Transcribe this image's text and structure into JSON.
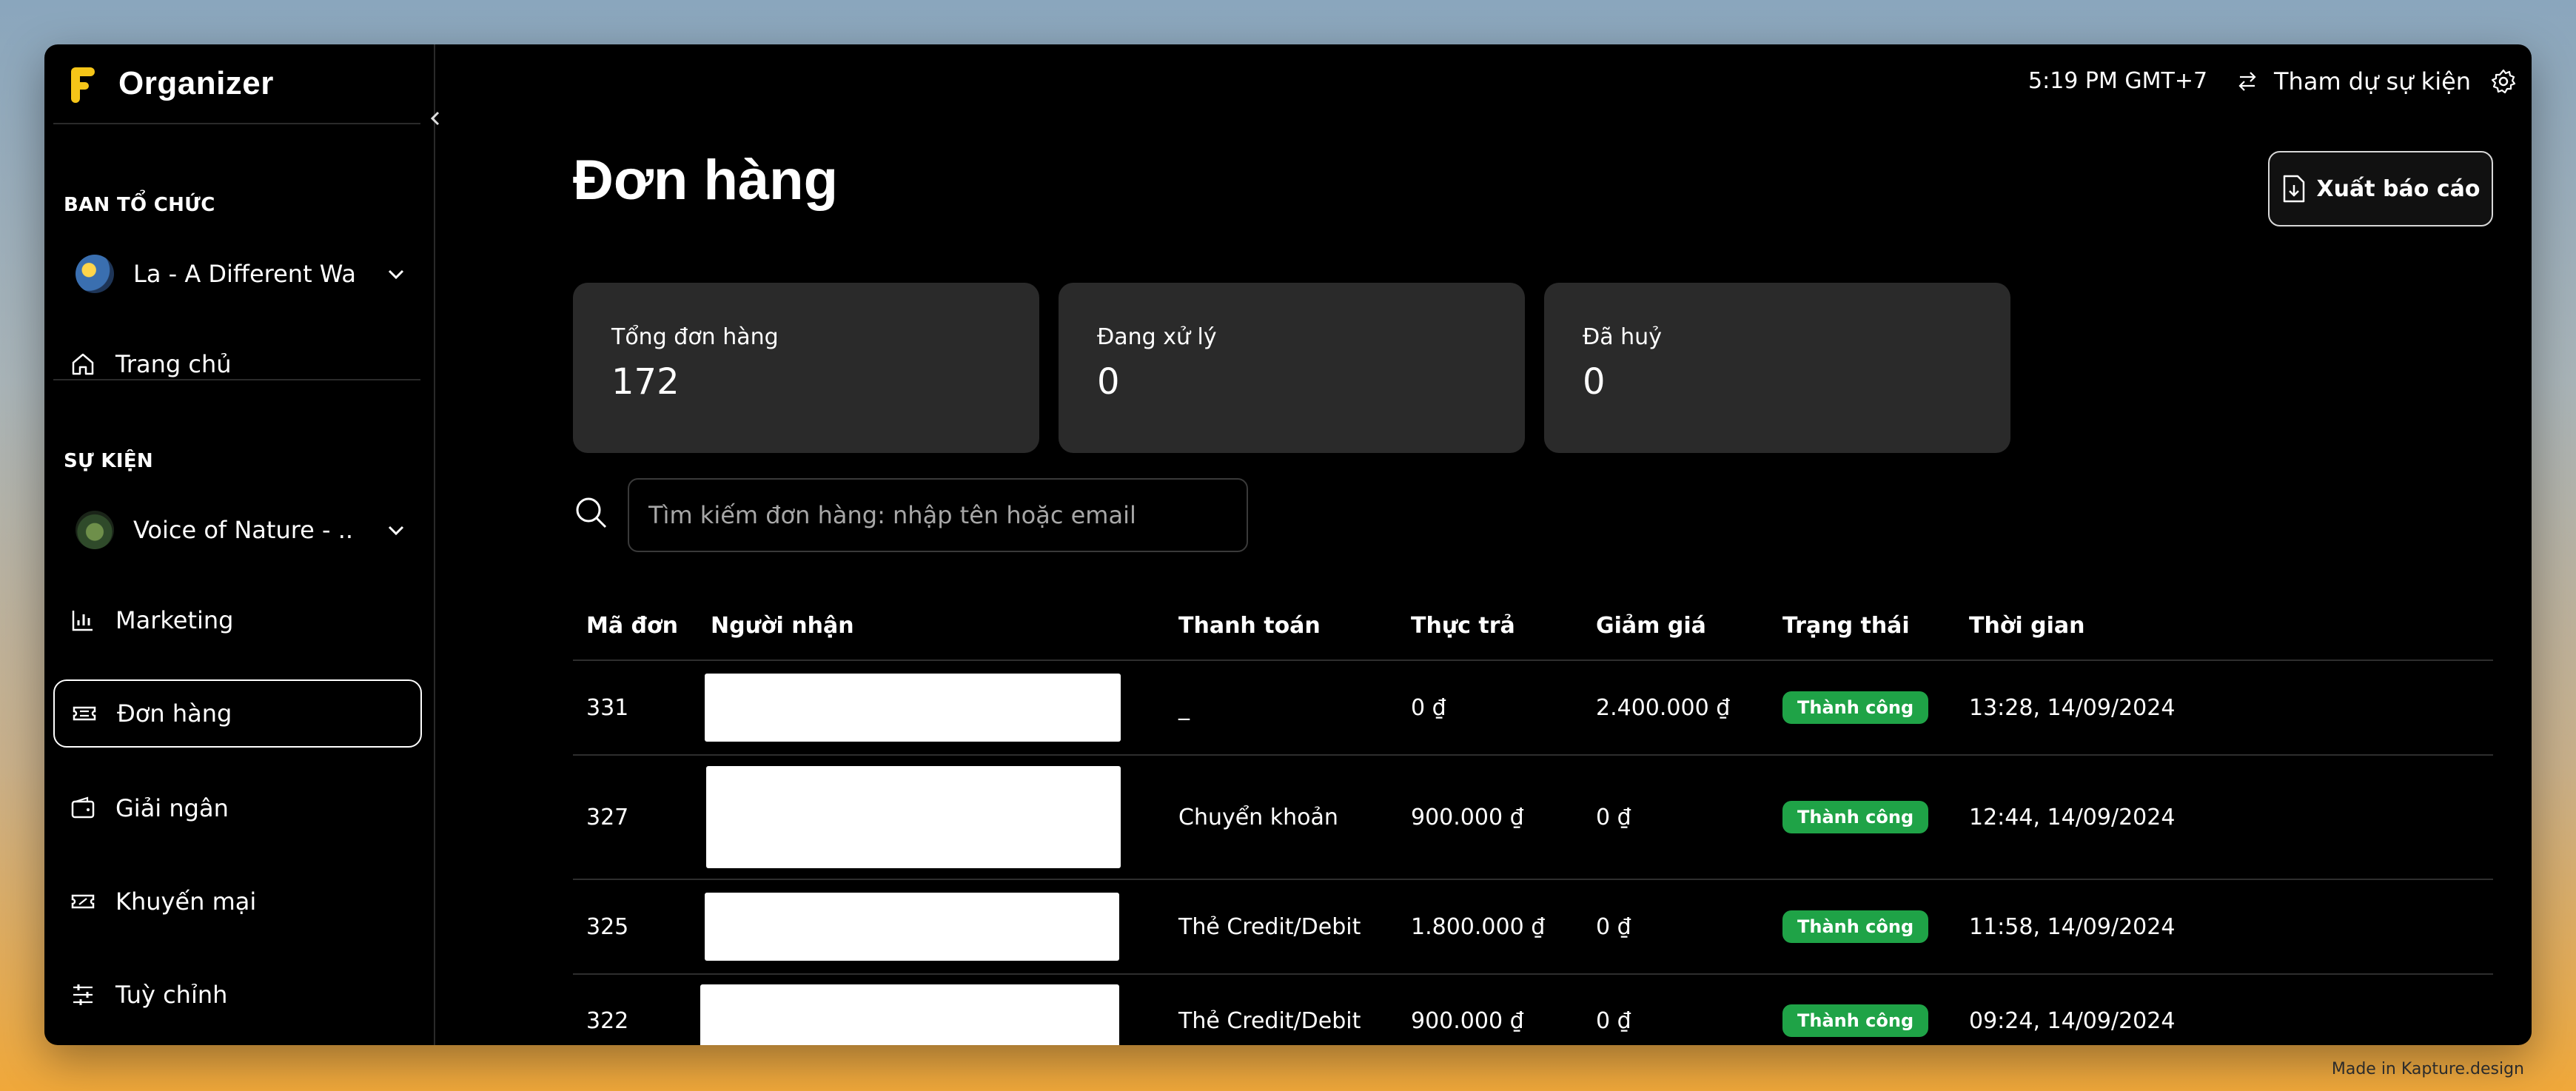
{
  "app": {
    "name": "Organizer"
  },
  "sidebar": {
    "organizer_section_label": "BAN TỔ CHỨC",
    "organizer_select": "La - A Different Wa...",
    "home_label": "Trang chủ",
    "event_section_label": "SỰ KIỆN",
    "event_select": "Voice of Nature - ...",
    "items": [
      {
        "label": "Marketing",
        "icon": "bar-chart-icon"
      },
      {
        "label": "Đơn hàng",
        "icon": "ticket-icon",
        "active": true
      },
      {
        "label": "Giải ngân",
        "icon": "wallet-icon"
      },
      {
        "label": "Khuyến mại",
        "icon": "coupon-icon"
      },
      {
        "label": "Tuỳ chỉnh",
        "icon": "sliders-icon"
      }
    ]
  },
  "topbar": {
    "time": "5:19 PM GMT+7",
    "attend_label": "Tham dự sự kiện"
  },
  "page": {
    "title": "Đơn hàng",
    "export_label": "Xuất báo cáo"
  },
  "stats": [
    {
      "label": "Tổng đơn hàng",
      "value": "172"
    },
    {
      "label": "Đang xử lý",
      "value": "0"
    },
    {
      "label": "Đã huỷ",
      "value": "0"
    }
  ],
  "search": {
    "placeholder": "Tìm kiếm đơn hàng: nhập tên hoặc email"
  },
  "table": {
    "columns": [
      "Mã đơn",
      "Người nhận",
      "Thanh toán",
      "Thực trả",
      "Giảm giá",
      "Trạng thái",
      "Thời gian"
    ],
    "rows": [
      {
        "id": "331",
        "payment": "_",
        "paid": "0 ₫",
        "discount": "2.400.000 ₫",
        "status": "Thành công",
        "time": "13:28, 14/09/2024"
      },
      {
        "id": "327",
        "payment": "Chuyển khoản",
        "paid": "900.000 ₫",
        "discount": "0 ₫",
        "status": "Thành công",
        "time": "12:44, 14/09/2024"
      },
      {
        "id": "325",
        "payment": "Thẻ Credit/Debit",
        "paid": "1.800.000 ₫",
        "discount": "0 ₫",
        "status": "Thành công",
        "time": "11:58, 14/09/2024"
      },
      {
        "id": "322",
        "payment": "Thẻ Credit/Debit",
        "paid": "900.000 ₫",
        "discount": "0 ₫",
        "status": "Thành công",
        "time": "09:24, 14/09/2024"
      }
    ]
  },
  "colors": {
    "accent": "#f5c518",
    "success": "#1fa347",
    "card": "#2a2a2a"
  },
  "footer": {
    "credit": "Made in Kapture.design"
  }
}
